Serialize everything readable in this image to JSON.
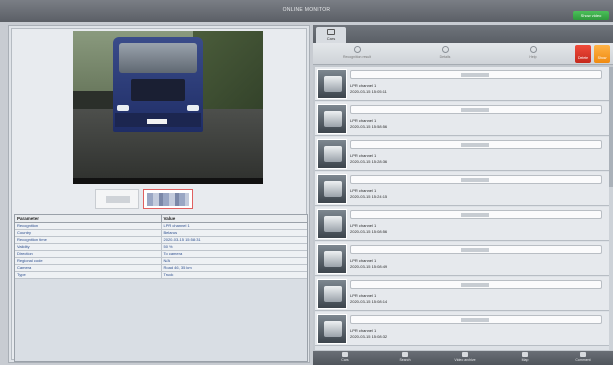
{
  "window": {
    "title": "ONLINE MONITOR",
    "show_button": "Show video"
  },
  "tabs": [
    {
      "label": "Cars",
      "icon": "car-icon"
    }
  ],
  "toolbar": {
    "items": [
      {
        "label": "Recognition result",
        "icon": "recognition-icon"
      },
      {
        "label": "Details",
        "icon": "details-icon"
      },
      {
        "label": "Help",
        "icon": "help-icon"
      }
    ],
    "delete_label": "Delete",
    "ok_label": "Show"
  },
  "params": {
    "header": {
      "parameter": "Parameter",
      "value": "Value"
    },
    "rows": [
      {
        "p": "Recognition",
        "v": "LPR channel 1"
      },
      {
        "p": "Country",
        "v": "Belarus"
      },
      {
        "p": "Recognition time",
        "v": "2020-03-15 15:58:31"
      },
      {
        "p": "Validity",
        "v": "50 %"
      },
      {
        "p": "Direction",
        "v": "To camera"
      },
      {
        "p": "Regional code",
        "v": "N/A"
      },
      {
        "p": "Camera",
        "v": "Road 46, 35 km"
      },
      {
        "p": "Type",
        "v": "Truck"
      }
    ]
  },
  "recognitions": [
    {
      "channel": "LPR channel 1",
      "time": "2020-03-15 15:05:11"
    },
    {
      "channel": "LPR channel 1",
      "time": "2020-03-15 15:58:56"
    },
    {
      "channel": "LPR channel 1",
      "time": "2020-03-15 15:28:36"
    },
    {
      "channel": "LPR channel 1",
      "time": "2020-03-15 15:24:15"
    },
    {
      "channel": "LPR channel 1",
      "time": "2020-03-15 15:08:56"
    },
    {
      "channel": "LPR channel 1",
      "time": "2020-03-15 15:08:49"
    },
    {
      "channel": "LPR channel 1",
      "time": "2020-03-15 15:08:14"
    },
    {
      "channel": "LPR channel 1",
      "time": "2020-03-15 15:08:32"
    }
  ],
  "bottom": [
    {
      "label": "Cars",
      "icon": "car-icon"
    },
    {
      "label": "Search",
      "icon": "search-icon"
    },
    {
      "label": "Video archive",
      "icon": "video-icon"
    },
    {
      "label": "Map",
      "icon": "map-icon"
    },
    {
      "label": "Comment",
      "icon": "comment-icon"
    }
  ]
}
